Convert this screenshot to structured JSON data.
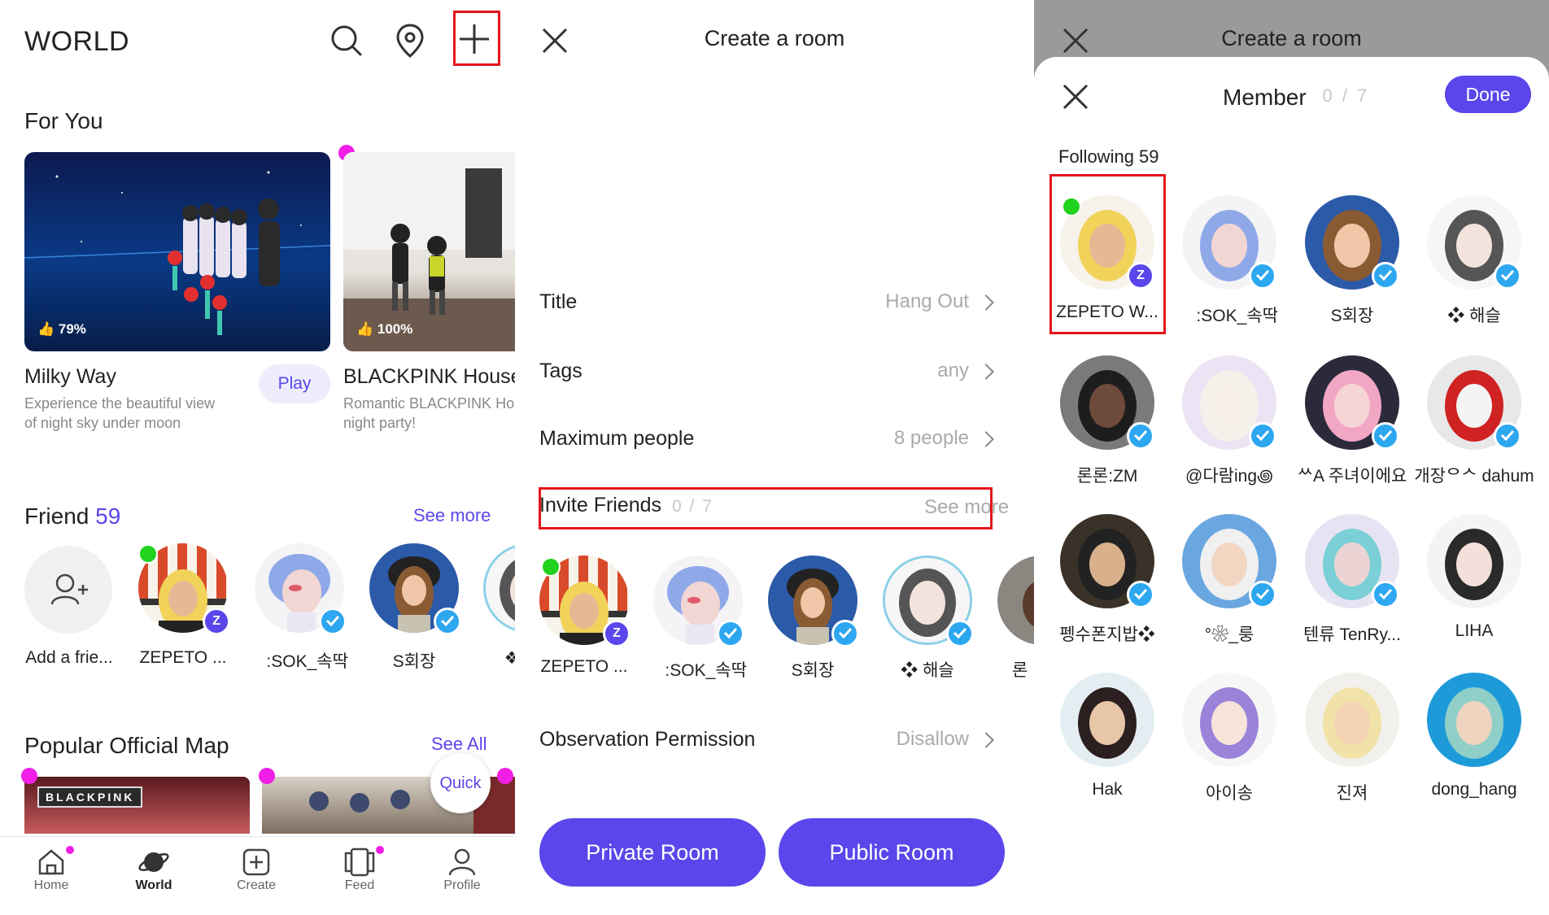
{
  "world": {
    "title": "WORLD",
    "for_you": "For You",
    "cards": [
      {
        "rating": "79%",
        "name": "Milky Way",
        "desc1": "Experience the beautiful view",
        "desc2": "of night sky under moon",
        "play": "Play"
      },
      {
        "rating": "100%",
        "name": "BLACKPINK House(I",
        "desc1": "Romantic BLACKPINK Ho",
        "desc2": "night party!"
      }
    ],
    "friend_label": "Friend",
    "friend_count": "59",
    "see_more": "See more",
    "friends": [
      {
        "name": "Add a frie..."
      },
      {
        "name": "ZEPETO ..."
      },
      {
        "name": "ᅟᅠ:SOK_속딱"
      },
      {
        "name": "S회장"
      },
      {
        "name": "❖"
      }
    ],
    "popular_label": "Popular Official Map",
    "see_all": "See All",
    "quick": "Quick",
    "map_logo": "BLACKPINK",
    "nav": [
      {
        "label": "Home",
        "icon": "home-icon"
      },
      {
        "label": "World",
        "icon": "planet-icon"
      },
      {
        "label": "Create",
        "icon": "plus-square-icon"
      },
      {
        "label": "Feed",
        "icon": "cards-icon"
      },
      {
        "label": "Profile",
        "icon": "person-icon"
      }
    ]
  },
  "create_room": {
    "title": "Create a room",
    "rows": [
      {
        "label": "Title",
        "value": "Hang Out"
      },
      {
        "label": "Tags",
        "value": "any"
      },
      {
        "label": "Maximum people",
        "value": "8 people"
      }
    ],
    "invite_label": "Invite Friends",
    "invite_count": "0 / 7",
    "invite_see_more": "See more",
    "invite_friends": [
      {
        "name": "ZEPETO ..."
      },
      {
        "name": "ᅟᅠ:SOK_속딱"
      },
      {
        "name": "S회장"
      },
      {
        "name": "❖ 해슬"
      },
      {
        "name": "론"
      }
    ],
    "observation_label": "Observation Permission",
    "observation_value": "Disallow",
    "private_btn": "Private Room",
    "public_btn": "Public Room"
  },
  "member": {
    "bg_title": "Create a room",
    "title": "Member",
    "count": "0 / 7",
    "done": "Done",
    "following": "Following 59",
    "members": [
      {
        "name": "ZEPETO W..."
      },
      {
        "name": "ᅟᅠ:SOK_속딱"
      },
      {
        "name": "S회장"
      },
      {
        "name": "❖ 해슬"
      },
      {
        "name": "론론:ZM"
      },
      {
        "name": "@다람ing꩜"
      },
      {
        "name": "ᄊA 주녀이에요"
      },
      {
        "name": "개장ᄋᄉ dahum"
      },
      {
        "name": "펭수폰지밥❖"
      },
      {
        "name": "°❀_룽"
      },
      {
        "name": "텐류 TenRy..."
      },
      {
        "name": "LIHA"
      },
      {
        "name": "Hak"
      },
      {
        "name": "아이송"
      },
      {
        "name": "진져"
      },
      {
        "name": "dong_hang"
      }
    ]
  },
  "colors": {
    "accent": "#5a46ea",
    "highlight": "#e5141c",
    "online": "#21d21f",
    "notify": "#f01ee6",
    "verified": "#2da7f0"
  }
}
